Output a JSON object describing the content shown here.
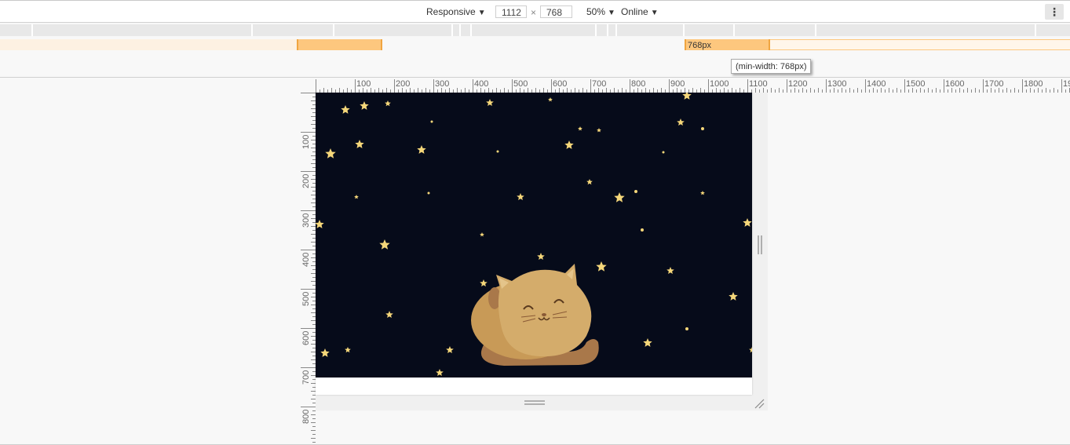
{
  "toolbar": {
    "device_label": "Responsive",
    "width_value": "1112",
    "height_value": "768",
    "times_symbol": "×",
    "zoom_label": "50%",
    "throttle_label": "Online",
    "more_icon": "kebab-icon"
  },
  "media_queries": {
    "breakpoint_label": "768px",
    "tooltip": "(min-width: 768px)"
  },
  "ruler_horizontal": [
    "100",
    "200",
    "300",
    "400",
    "500",
    "600",
    "700",
    "800",
    "900",
    "1000",
    "1100",
    "1200",
    "1300",
    "1400",
    "1500",
    "1600",
    "1700",
    "1800",
    "19"
  ],
  "ruler_vertical": [
    "100",
    "200",
    "300",
    "400",
    "500",
    "600",
    "700",
    "800"
  ],
  "scene": {
    "background": "#060b1a",
    "star_color": "#f5d77a",
    "cat_body_color": "#d4ac6b",
    "cat_tail_color": "#a9784a"
  }
}
